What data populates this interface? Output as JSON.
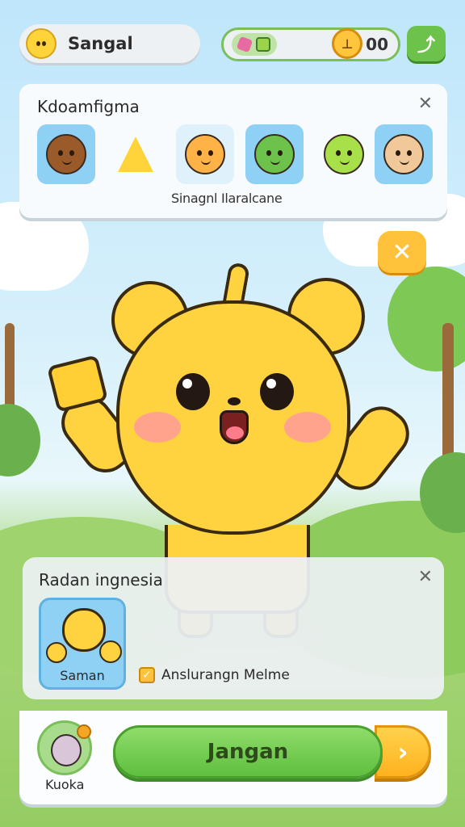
{
  "header": {
    "player_name": "Sangal",
    "coin_count": "00"
  },
  "character_panel": {
    "title": "Kdoamfigma",
    "caption": "Sinagnl Ilaralcane",
    "characters": [
      {
        "icon": "spiky-creature-icon"
      },
      {
        "icon": "star-creature-icon"
      },
      {
        "icon": "orange-bear-icon"
      },
      {
        "icon": "green-frog-icon"
      },
      {
        "icon": "green-virus-icon"
      },
      {
        "icon": "tan-bear-icon"
      }
    ]
  },
  "reward_panel": {
    "title": "Radan ingnesia",
    "card_label": "Saman",
    "checkbox_label": "Anslurangn Melme",
    "checkbox_checked": true
  },
  "action_bar": {
    "pet_label": "Kuoka",
    "play_label": "Jangan"
  },
  "colors": {
    "accent_green": "#6cc24a",
    "accent_yellow": "#ffc23a",
    "hero_yellow": "#ffd33f"
  }
}
